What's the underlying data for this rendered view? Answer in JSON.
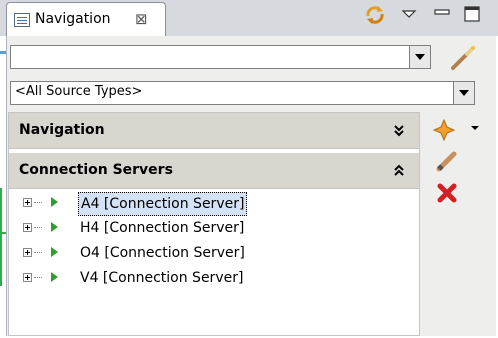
{
  "view": {
    "tab_label": "Navigation",
    "close_glyph": "⊠",
    "toolbar_icons": [
      "sync-icon",
      "view-menu-icon",
      "minimize-icon",
      "maximize-icon"
    ]
  },
  "search": {
    "value": "",
    "placeholder": ""
  },
  "source_filter": {
    "selected": "<All Source Types>"
  },
  "sections": {
    "navigation": {
      "title": "Navigation",
      "state": "collapsed",
      "chevron": "»"
    },
    "connection_servers": {
      "title": "Connection Servers",
      "state": "expanded",
      "chevron": "«"
    }
  },
  "tree": {
    "items": [
      {
        "label": "A4 [Connection Server]",
        "selected": true
      },
      {
        "label": "H4 [Connection Server]",
        "selected": false
      },
      {
        "label": "O4 [Connection Server]",
        "selected": false
      },
      {
        "label": "V4 [Connection Server]",
        "selected": false
      }
    ]
  },
  "actions": {
    "icons": [
      "new-star-icon",
      "edit-pencil-icon",
      "delete-x-icon"
    ]
  },
  "colors": {
    "tab_strip": "#d6d9de",
    "section_header": "#d9d6cf",
    "selection": "#d4e2f6",
    "tree_arrow": "#2f9e2f",
    "delete": "#d42020",
    "star": "#f0a030"
  }
}
